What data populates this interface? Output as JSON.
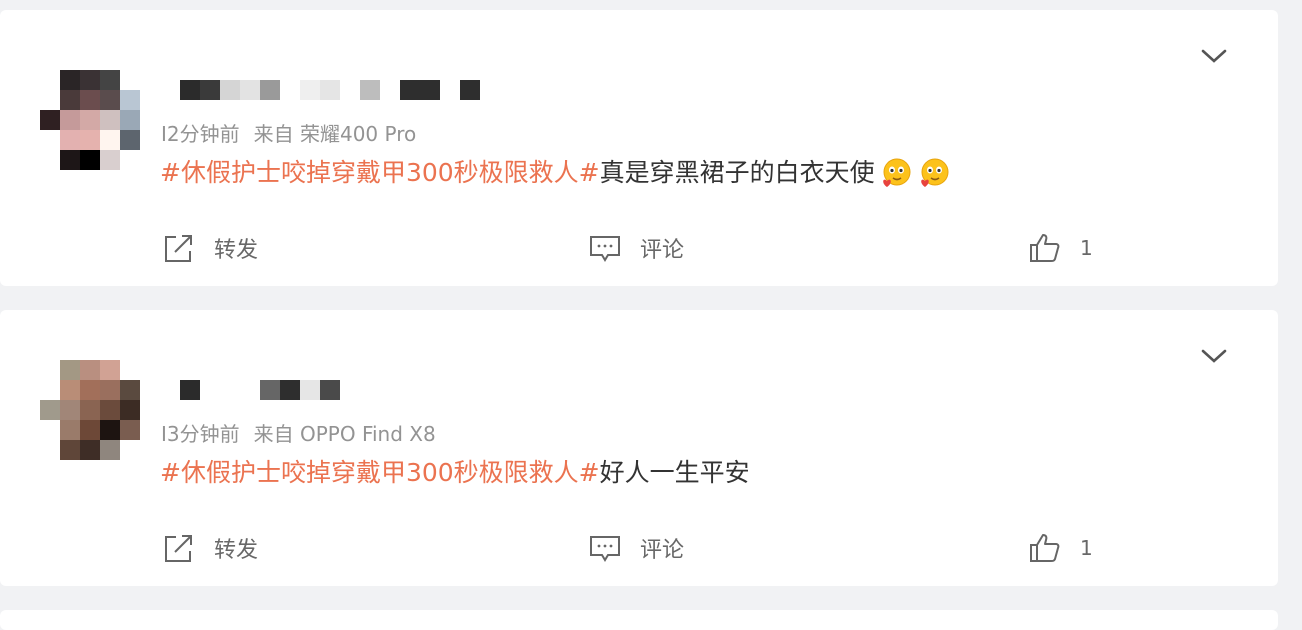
{
  "posts": [
    {
      "meta_time": "I2分钟前",
      "meta_source": "来自 荣耀400 Pro",
      "topic": "#休假护士咬掉穿戴甲300秒极限救人#",
      "body": "真是穿黑裙子的白衣天使",
      "emojis": [
        "smiling-heart-emoji",
        "smiling-heart-emoji"
      ],
      "actions": {
        "forward": "转发",
        "comment": "评论",
        "like_count": "1"
      }
    },
    {
      "meta_time": "I3分钟前",
      "meta_source": "来自 OPPO Find X8",
      "topic": "#休假护士咬掉穿戴甲300秒极限救人#",
      "body": "好人一生平安",
      "emojis": [],
      "actions": {
        "forward": "转发",
        "comment": "评论",
        "like_count": "1"
      }
    }
  ],
  "icons": {
    "forward": "share-icon",
    "comment": "comment-icon",
    "like": "thumbs-up-icon",
    "menu": "chevron-down-icon"
  },
  "colors": {
    "topic": "#eb7350",
    "text": "#333333",
    "meta": "#939393",
    "background": "#f1f2f4",
    "card": "#ffffff"
  }
}
